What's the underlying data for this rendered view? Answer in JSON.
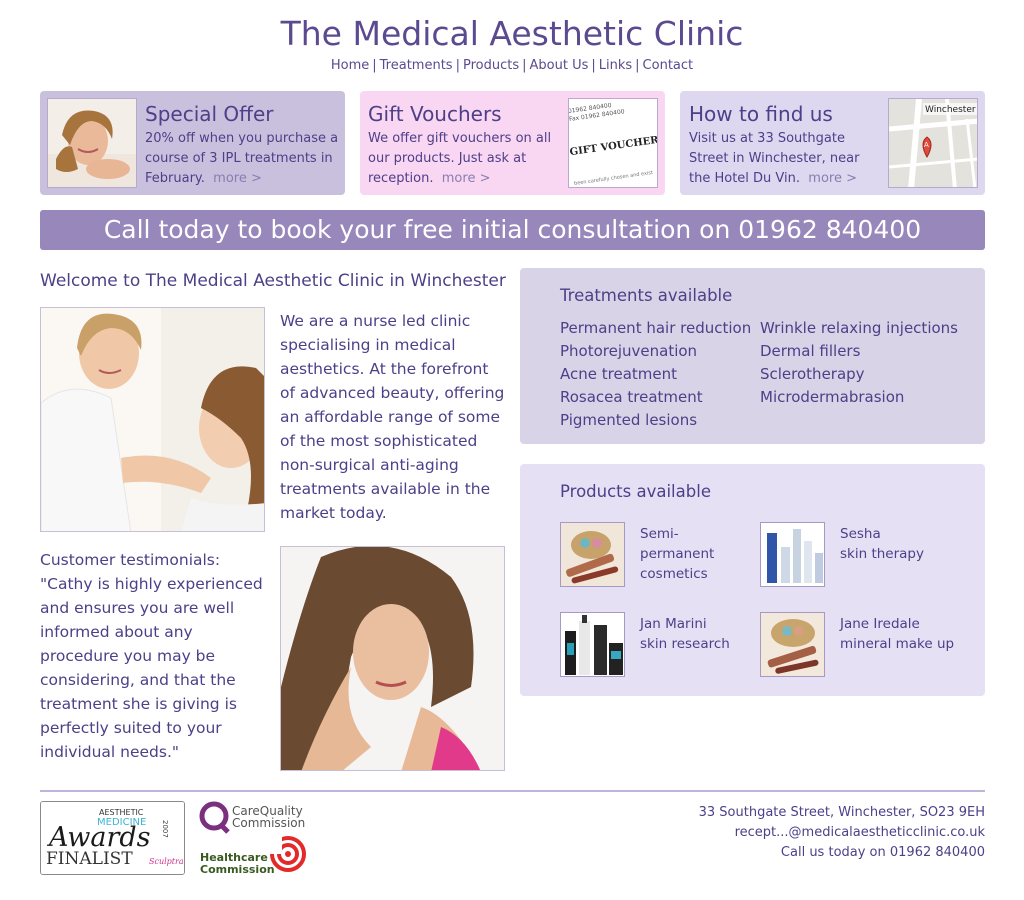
{
  "header": {
    "title": "The Medical Aesthetic Clinic",
    "nav": [
      "Home",
      "Treatments",
      "Products",
      "About Us",
      "Links",
      "Contact"
    ],
    "nav_separator": "|"
  },
  "promos": [
    {
      "title": "Special Offer",
      "text": "20% off when you purchase a course of 3 IPL treatments in February.",
      "more": "more >"
    },
    {
      "title": "Gift Vouchers",
      "text": "We offer gift vouchers on all our products. Just ask at reception.",
      "more": "more >",
      "image_text": {
        "line1": "01962 840400",
        "line2": "Fax 01962 840400",
        "voucher": "GIFT VOUCHER",
        "small": "been carefully chosen and exist"
      }
    },
    {
      "title": "How to find us",
      "text": "Visit us at 33 Southgate Street in Winchester, near the Hotel Du Vin.",
      "more": "more >",
      "map_text": {
        "city": "Winchester",
        "marker": "A"
      }
    }
  ],
  "callbar": {
    "text": "Call today to book your free initial consultation on 01962 840400"
  },
  "welcome": {
    "title": "Welcome to The Medical Aesthetic Clinic in Winchester",
    "intro": "We are a nurse led clinic specialising in medical aesthetics. At the forefront of advanced beauty, offering an affordable range of some of the most sophisticated non-surgical anti-aging treatments available in the market today.",
    "testimonial_heading": "Customer testimonials:",
    "testimonial": "\"Cathy is highly experienced and ensures you are well informed about any procedure you may be considering, and that the treatment she is giving is perfectly suited to your individual needs.\""
  },
  "treatments": {
    "title": "Treatments available",
    "col1": [
      "Permanent hair reduction",
      "Photorejuvenation",
      "Acne treatment",
      "Rosacea treatment",
      "Pigmented lesions"
    ],
    "col2": [
      "Wrinkle relaxing injections",
      "Dermal fillers",
      "Sclerotherapy",
      "Microdermabrasion"
    ]
  },
  "products": {
    "title": "Products available",
    "items": [
      {
        "line1": "Semi-",
        "line2": "permanent",
        "line3": "cosmetics"
      },
      {
        "line1": "Sesha",
        "line2": "skin therapy"
      },
      {
        "line1": "Jan Marini",
        "line2": "skin research"
      },
      {
        "line1": "Jane Iredale",
        "line2": "mineral make up"
      }
    ]
  },
  "footer": {
    "award": {
      "top": "AESTHETIC",
      "middle": "MEDICINE",
      "script": "Awards",
      "year": "2007",
      "finalist": "FINALIST",
      "sponsor": "Sculptra"
    },
    "cqc": {
      "line1": "CareQuality",
      "line2": "Commission"
    },
    "hc": {
      "line1": "Healthcare",
      "line2": "Commission"
    },
    "address": "33 Southgate Street, Winchester, SO23 9EH",
    "email": "recept...@medicalaestheticclinic.co.uk",
    "phone": "Call us today on 01962 840400"
  },
  "colors": {
    "brand_purple": "#5b4a8f",
    "callbar": "#9787bb",
    "special_offer_bg": "#c9c0de",
    "gift_voucher_bg": "#f9d6f2",
    "find_us_bg": "#ddd8f0",
    "treatments_bg": "#d8d3e6",
    "products_bg": "#e6e0f5"
  }
}
